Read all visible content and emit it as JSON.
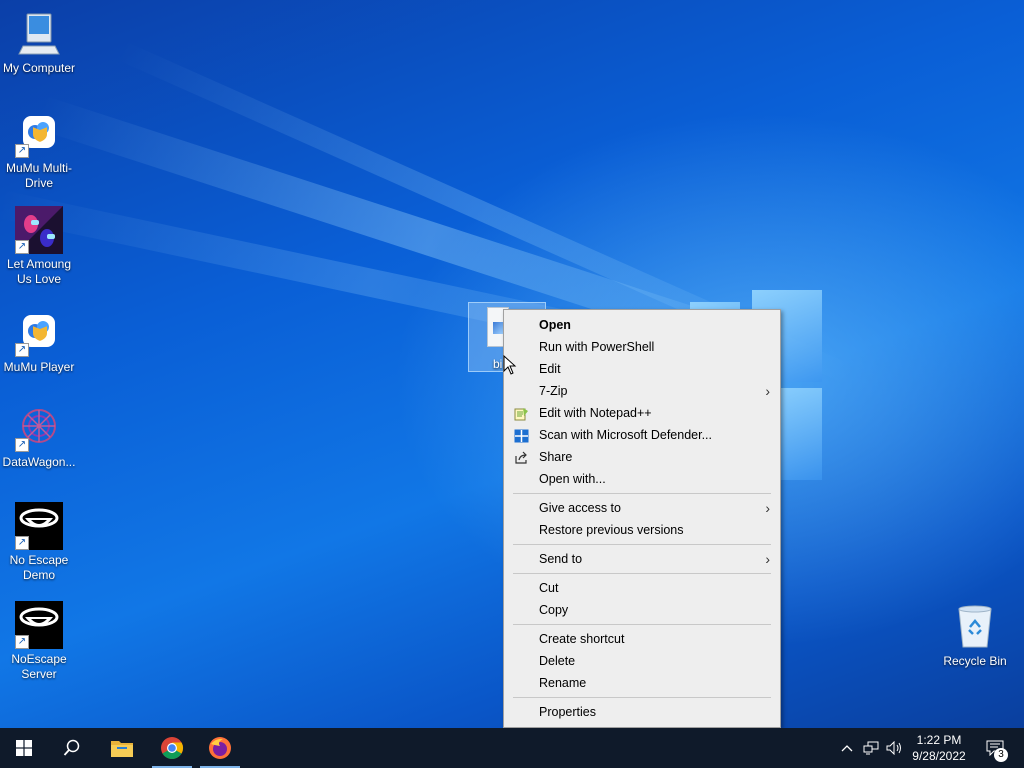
{
  "desktop": {
    "icons": [
      {
        "label": "My Computer",
        "icon": "computer-icon",
        "shortcut": false
      },
      {
        "label": "MuMu Multi-Drive",
        "icon": "mumu-multi-drive-icon",
        "shortcut": true
      },
      {
        "label": "Let Amoung Us Love",
        "icon": "among-us-icon",
        "shortcut": true
      },
      {
        "label": "MuMu Player",
        "icon": "mumu-player-icon",
        "shortcut": true
      },
      {
        "label": "DataWagon...",
        "icon": "datawagon-icon",
        "shortcut": true
      },
      {
        "label": "No Escape Demo",
        "icon": "no-escape-icon",
        "shortcut": true
      },
      {
        "label": "NoEscape Server",
        "icon": "noescape-server-icon",
        "shortcut": true
      }
    ],
    "recycle_bin": {
      "label": "Recycle Bin",
      "icon": "recycle-bin-icon"
    },
    "selected_file": {
      "label": "bi",
      "icon": "script-file-icon"
    }
  },
  "context_menu": {
    "items": [
      {
        "label": "Open",
        "bold": true
      },
      {
        "label": "Run with PowerShell"
      },
      {
        "label": "Edit"
      },
      {
        "label": "7-Zip",
        "submenu": true
      },
      {
        "label": "Edit with Notepad++",
        "icon": "notepad-plus-plus-icon"
      },
      {
        "label": "Scan with Microsoft Defender...",
        "icon": "defender-icon"
      },
      {
        "label": "Share",
        "icon": "share-icon"
      },
      {
        "label": "Open with..."
      },
      {
        "label": "Give access to",
        "submenu": true
      },
      {
        "label": "Restore previous versions"
      },
      {
        "label": "Send to",
        "submenu": true
      },
      {
        "label": "Cut"
      },
      {
        "label": "Copy"
      },
      {
        "label": "Create shortcut"
      },
      {
        "label": "Delete"
      },
      {
        "label": "Rename"
      },
      {
        "label": "Properties"
      }
    ]
  },
  "taskbar": {
    "buttons": [
      "start-button",
      "search-button",
      "file-explorer-button",
      "chrome-button",
      "firefox-button"
    ],
    "clock": {
      "time": "1:22 PM",
      "date": "9/28/2022"
    },
    "notifications_count": "3"
  },
  "colors": {
    "accent": "#0a5fd6",
    "taskbar": "#0f1a2a",
    "menu_bg": "#eeeeee"
  }
}
